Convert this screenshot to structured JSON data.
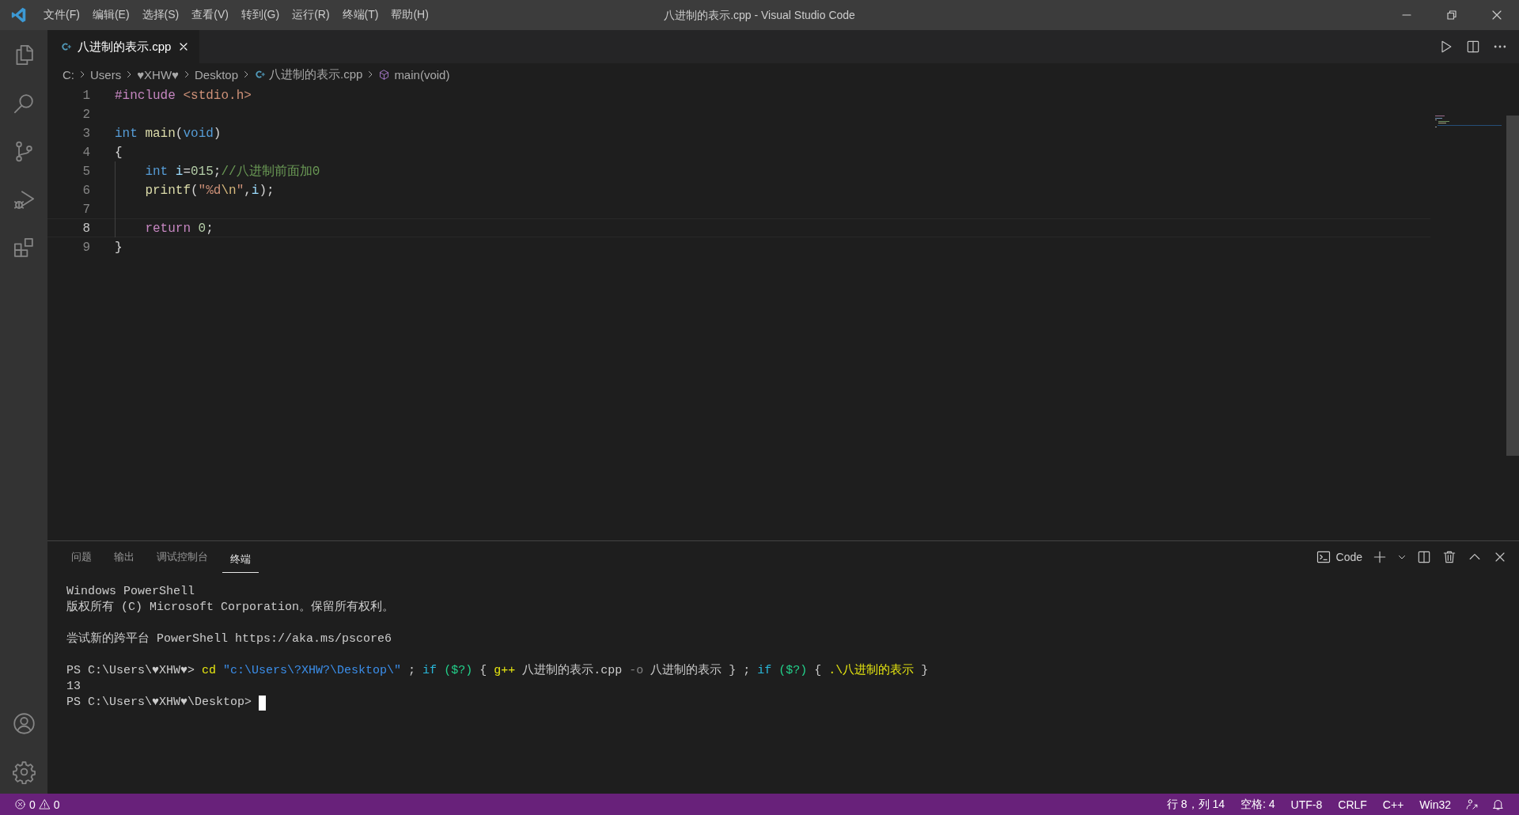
{
  "title_bar": {
    "menu": [
      "文件(F)",
      "编辑(E)",
      "选择(S)",
      "查看(V)",
      "转到(G)",
      "运行(R)",
      "终端(T)",
      "帮助(H)"
    ],
    "title": "八进制的表示.cpp - Visual Studio Code"
  },
  "editor": {
    "tabs": [
      {
        "label": "八进制的表示.cpp",
        "selected": true
      }
    ],
    "breadcrumbs": [
      {
        "kind": "folder",
        "label": "C:"
      },
      {
        "kind": "folder",
        "label": "Users"
      },
      {
        "kind": "folder",
        "label": "♥XHW♥"
      },
      {
        "kind": "folder",
        "label": "Desktop"
      },
      {
        "kind": "file",
        "label": "八进制的表示.cpp"
      },
      {
        "kind": "symbol",
        "label": "main(void)"
      }
    ],
    "lines": [
      {
        "number": "1",
        "current": false,
        "indented": false,
        "tokens": [
          {
            "kind": "directive",
            "text": "#include "
          },
          {
            "kind": "header",
            "text": "<stdio.h>"
          }
        ]
      },
      {
        "number": "2",
        "current": false,
        "indented": false
      },
      {
        "number": "3",
        "current": false,
        "indented": false,
        "tokens": [
          {
            "kind": "type",
            "text": "int "
          },
          {
            "kind": "function",
            "text": "main"
          },
          {
            "kind": "plain",
            "text": "("
          },
          {
            "kind": "type",
            "text": "void"
          },
          {
            "kind": "plain",
            "text": ")"
          }
        ]
      },
      {
        "number": "4",
        "current": false,
        "indented": false,
        "tokens": [
          {
            "kind": "plain",
            "text": "{"
          }
        ]
      },
      {
        "number": "5",
        "current": false,
        "indented": true,
        "tokens": [
          {
            "kind": "type",
            "text": "int "
          },
          {
            "kind": "variable",
            "text": "i"
          },
          {
            "kind": "plain",
            "text": "="
          },
          {
            "kind": "number",
            "text": "015"
          },
          {
            "kind": "plain",
            "text": ";"
          },
          {
            "kind": "comment",
            "text": "//八进制前面加0"
          }
        ]
      },
      {
        "number": "6",
        "current": false,
        "indented": true,
        "tokens": [
          {
            "kind": "function",
            "text": "printf"
          },
          {
            "kind": "plain",
            "text": "("
          },
          {
            "kind": "string",
            "text": "\"%d"
          },
          {
            "kind": "escape",
            "text": "\\n"
          },
          {
            "kind": "string",
            "text": "\""
          },
          {
            "kind": "plain",
            "text": ","
          },
          {
            "kind": "variable",
            "text": "i"
          },
          {
            "kind": "plain",
            "text": ");"
          }
        ]
      },
      {
        "number": "7",
        "current": false,
        "indented": true
      },
      {
        "number": "8",
        "current": true,
        "indented": true,
        "tokens": [
          {
            "kind": "keyword",
            "text": "return "
          },
          {
            "kind": "number",
            "text": "0"
          },
          {
            "kind": "plain",
            "text": ";"
          }
        ]
      },
      {
        "number": "9",
        "current": false,
        "indented": false,
        "tokens": [
          {
            "kind": "plain",
            "text": "}"
          }
        ]
      }
    ]
  },
  "panel": {
    "tabs": [
      {
        "label": "问题",
        "selected": false
      },
      {
        "label": "输出",
        "selected": false
      },
      {
        "label": "调试控制台",
        "selected": false
      },
      {
        "label": "终端",
        "selected": true
      }
    ],
    "terminal_profile": "Code",
    "cursor": true,
    "terminal_blocks": [
      {
        "lines": [
          {
            "tokens": [
              {
                "kind": "plain",
                "text": "Windows PowerShell"
              }
            ]
          },
          {
            "tokens": [
              {
                "kind": "plain",
                "text": "版权所有 (C) Microsoft Corporation。保留所有权利。"
              }
            ]
          }
        ]
      },
      {
        "lines": [
          {
            "tokens": [
              {
                "kind": "plain",
                "text": "尝试新的跨平台 PowerShell https://aka.ms/pscore6"
              }
            ]
          }
        ]
      },
      {
        "lines": [
          {
            "tokens": [
              {
                "kind": "plain",
                "text": "PS C:\\Users\\♥XHW♥> "
              },
              {
                "kind": "command",
                "text": "cd"
              },
              {
                "kind": "string",
                "text": " \"c:\\Users\\?XHW?\\Desktop\\\""
              },
              {
                "kind": "plain",
                "text": " ; "
              },
              {
                "kind": "keyword",
                "text": "if"
              },
              {
                "kind": "variable",
                "text": " ($?)"
              },
              {
                "kind": "plain",
                "text": " { "
              },
              {
                "kind": "command",
                "text": "g++"
              },
              {
                "kind": "plain",
                "text": " 八进制的表示.cpp "
              },
              {
                "kind": "param",
                "text": "-o"
              },
              {
                "kind": "plain",
                "text": " 八进制的表示 } ; "
              },
              {
                "kind": "keyword",
                "text": "if"
              },
              {
                "kind": "variable",
                "text": " ($?)"
              },
              {
                "kind": "plain",
                "text": " { "
              },
              {
                "kind": "command",
                "text": ".\\八进制的表示"
              },
              {
                "kind": "plain",
                "text": " }"
              }
            ]
          },
          {
            "tokens": [
              {
                "kind": "plain",
                "text": "13"
              }
            ]
          },
          {
            "tokens": [
              {
                "kind": "plain",
                "text": "PS C:\\Users\\♥XHW♥\\Desktop> "
              }
            ]
          }
        ]
      }
    ]
  },
  "status_bar": {
    "errors": "0",
    "warnings": "0",
    "items": [
      "行 8，列 14",
      "空格: 4",
      "UTF-8",
      "CRLF",
      "C++",
      "Win32"
    ]
  }
}
